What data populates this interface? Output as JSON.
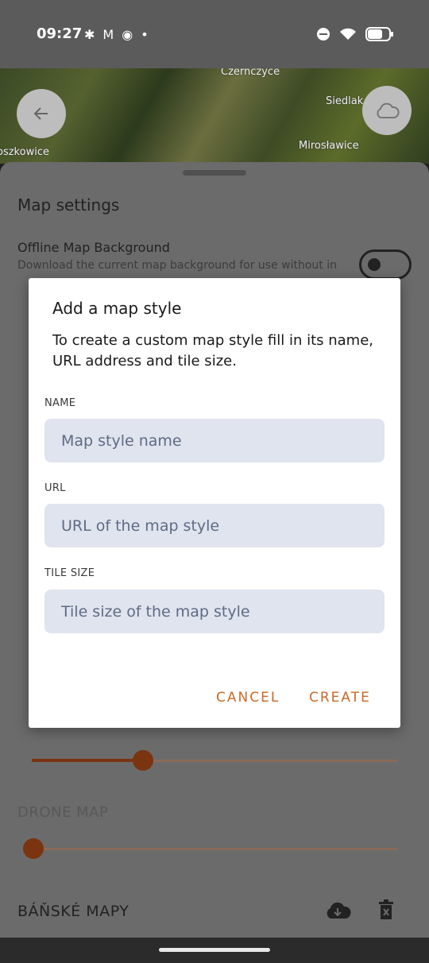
{
  "status_bar": {
    "time": "09:27"
  },
  "map": {
    "labels": [
      "Czernczyce",
      "Siedlak",
      "Mirosławice",
      "oszkowice"
    ]
  },
  "sheet": {
    "title": "Map settings",
    "offline": {
      "label": "Offline Map Background",
      "description": "Download the current map background for use without in",
      "enabled": false
    },
    "sliders": [
      {
        "value": 0.3
      },
      {
        "value": 0.0
      }
    ],
    "drone_map_label": "DRONE MAP",
    "banske_label": "BÁŇSKÉ MAPY"
  },
  "dialog": {
    "title": "Add a map style",
    "description": "To create a custom map style fill in its name, URL address and tile size.",
    "fields": {
      "name": {
        "label": "NAME",
        "placeholder": "Map style name"
      },
      "url": {
        "label": "URL",
        "placeholder": "URL of the map style"
      },
      "tile_size": {
        "label": "TILE SIZE",
        "placeholder": "Tile size of the map style"
      }
    },
    "cancel_label": "CANCEL",
    "create_label": "CREATE"
  },
  "colors": {
    "accent": "#c96a2a",
    "input_bg": "#dfe4ee",
    "slider": "#7a3410"
  }
}
